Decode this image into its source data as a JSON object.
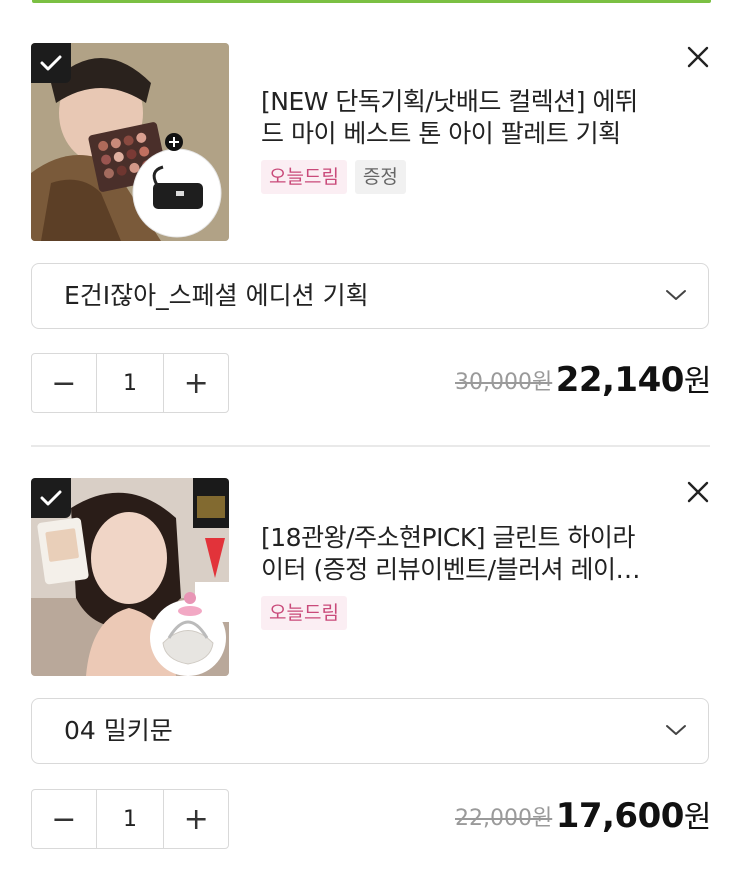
{
  "items": [
    {
      "title_line1": "[NEW 단독기획/낫배드 컬렉션] 에뛰",
      "title_line2": "드 마이 베스트 톤 아이 팔레트 기획",
      "tags": [
        "오늘드림",
        "증정"
      ],
      "option": "E건I잖아_스페셜 에디션 기획",
      "quantity": "1",
      "original_price": "30,000원",
      "price": "22,140",
      "price_unit": "원"
    },
    {
      "title_line1": "[18관왕/주소현PICK] 글린트 하이라",
      "title_line2": "이터 (증정 리뷰이벤트/블러셔 레이…",
      "tags": [
        "오늘드림"
      ],
      "option": "04 밀키문",
      "quantity": "1",
      "original_price": "22,000원",
      "price": "17,600",
      "price_unit": "원"
    }
  ],
  "stepper": {
    "minus": "−",
    "plus": "+"
  },
  "colors": {
    "accent_green": "#7bc043",
    "tag_dream_bg": "#fbeef3",
    "tag_dream_text": "#c94a7a"
  }
}
